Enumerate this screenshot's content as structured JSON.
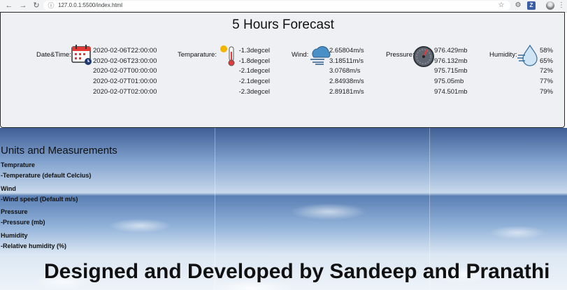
{
  "browser": {
    "url": "127.0.0.1:5500/index.html",
    "back_icon": "back-arrow-icon",
    "forward_icon": "forward-arrow-icon",
    "reload_icon": "reload-icon"
  },
  "forecast": {
    "title": "5 Hours Forecast",
    "labels": {
      "datetime": "Date&Time:",
      "temperature": "Temparature:",
      "wind": "Wind:",
      "pressure": "Pressure:",
      "humidity": "Humidity:"
    },
    "datetimes": [
      "2020-02-06T22:00:00",
      "2020-02-06T23:00:00",
      "2020-02-07T00:00:00",
      "2020-02-07T01:00:00",
      "2020-02-07T02:00:00"
    ],
    "temperatures": [
      "-1.3degcel",
      "-1.8degcel",
      "-2.1degcel",
      "-2.1degcel",
      "-2.3degcel"
    ],
    "winds": [
      "2.65804m/s",
      "3.18511m/s",
      "3.0768m/s",
      "2.84938m/s",
      "2.89181m/s"
    ],
    "pressures": [
      "976.429mb",
      "976.132mb",
      "975.715mb",
      "975.05mb",
      "974.501mb"
    ],
    "humidities": [
      "58%",
      "65%",
      "72%",
      "77%",
      "79%"
    ]
  },
  "units": {
    "title": "Units and Measurements",
    "temp_head": "Temprature",
    "temp_desc": "-Temperature (default Celcius)",
    "wind_head": "Wind",
    "wind_desc": "-Wind speed (Default m/s)",
    "pressure_head": "Pressure",
    "pressure_desc": "-Pressure (mb)",
    "humidity_head": "Humidity",
    "humidity_desc": "-Relative humidity (%)"
  },
  "footer": "Designed and Developed by Sandeep and Pranathi"
}
